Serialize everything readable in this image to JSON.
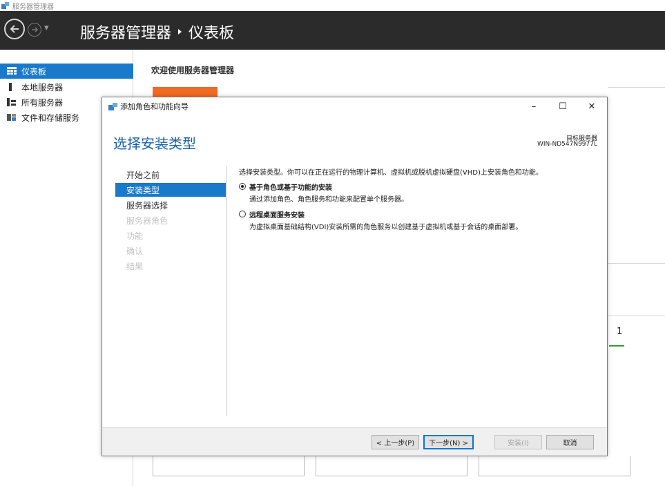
{
  "window": {
    "title": "服务器管理器"
  },
  "header": {
    "title_app": "服务器管理器",
    "title_page": "仪表板"
  },
  "sidebar": {
    "items": [
      {
        "label": "仪表板",
        "icon": "dashboard-icon",
        "active": true
      },
      {
        "label": "本地服务器",
        "icon": "local-server-icon",
        "active": false
      },
      {
        "label": "所有服务器",
        "icon": "all-servers-icon",
        "active": false
      },
      {
        "label": "文件和存储服务",
        "icon": "file-storage-icon",
        "active": false
      }
    ]
  },
  "main": {
    "welcome": "欢迎使用服务器管理器",
    "count": "1"
  },
  "dialog": {
    "title": "添加角色和功能向导",
    "controls": {
      "minimize": "–",
      "maximize": "☐",
      "close": "✕"
    },
    "heading": "选择安装类型",
    "target_label": "目标服务器",
    "target_server": "WIN-ND547N9977L",
    "steps": [
      {
        "label": "开始之前",
        "state": "normal"
      },
      {
        "label": "安装类型",
        "state": "active"
      },
      {
        "label": "服务器选择",
        "state": "normal"
      },
      {
        "label": "服务器角色",
        "state": "disabled"
      },
      {
        "label": "功能",
        "state": "disabled"
      },
      {
        "label": "确认",
        "state": "disabled"
      },
      {
        "label": "结果",
        "state": "disabled"
      }
    ],
    "intro": "选择安装类型。你可以在正在运行的物理计算机、虚拟机或脱机虚拟硬盘(VHD)上安装角色和功能。",
    "options": [
      {
        "title": "基于角色或基于功能的安装",
        "desc": "通过添加角色、角色服务和功能来配置单个服务器。",
        "checked": true
      },
      {
        "title": "远程桌面服务安装",
        "desc": "为虚拟桌面基础结构(VDI)安装所需的角色服务以创建基于虚拟机或基于会话的桌面部署。",
        "checked": false
      }
    ],
    "buttons": {
      "prev": "< 上一步(P)",
      "next": "下一步(N) >",
      "install": "安装(I)",
      "cancel": "取消"
    }
  },
  "colors": {
    "accent": "#1979ca",
    "header_bg": "#2b2b2b",
    "orange": "#f26a21",
    "heading": "#1a5fa8"
  }
}
